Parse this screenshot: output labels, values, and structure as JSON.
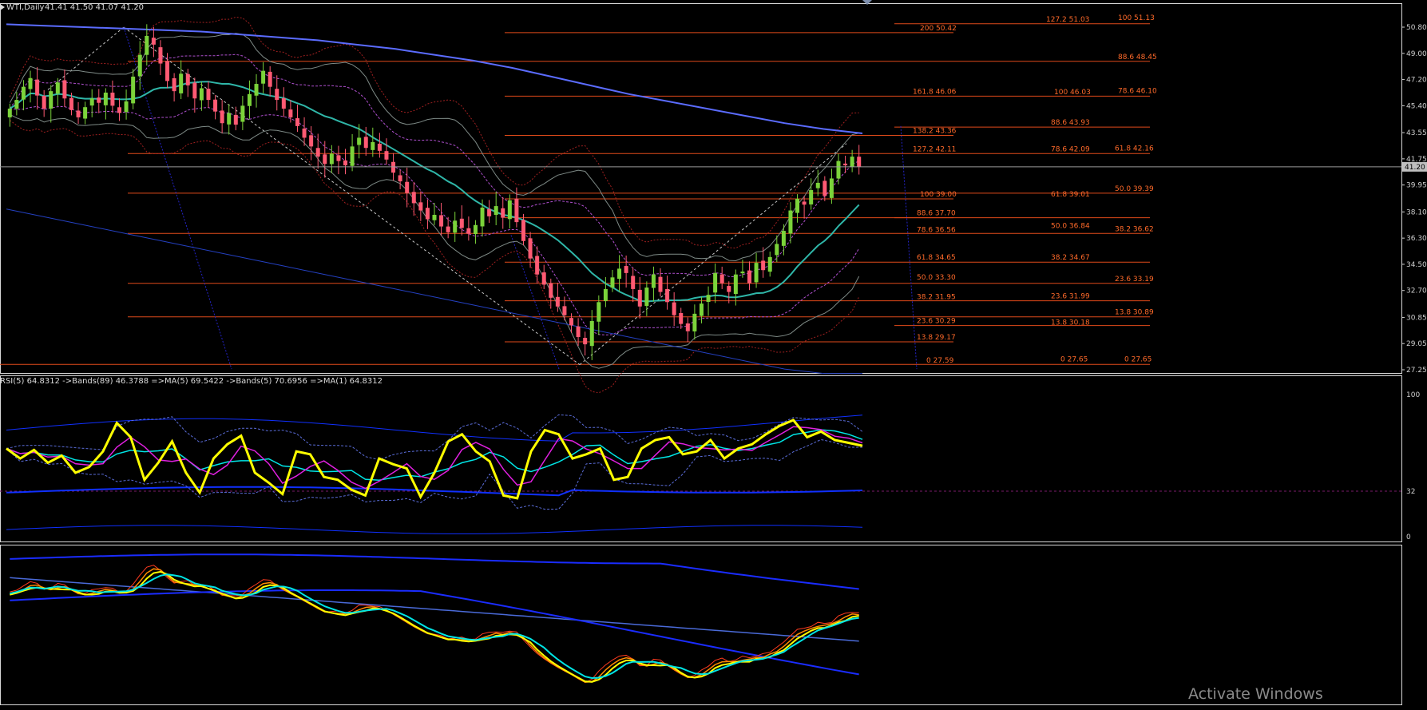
{
  "header": {
    "symbol_label": "WTI,Daily",
    "ohlc_label": "41.41 41.50 41.07 41.20"
  },
  "colors": {
    "background": "#000000",
    "bull_candle": "#7bd33a",
    "bear_candle": "#ff5a73",
    "fib_line": "#e04a1a",
    "fib_text": "#ff6a2a",
    "ma_blue": "#5b6cff",
    "ma_teal": "#2fb6a8",
    "band_gray": "#7e8a86",
    "band_purple": "#b050d0",
    "band_red": "#a02020",
    "rsi_yellow": "#ffff00",
    "rsi_cyan": "#00e5e5",
    "rsi_magenta": "#e020e0",
    "rsi_band_blue": "#1030ff",
    "axis_text": "#cfcfcf",
    "price_marker_bg": "#bfbfbf",
    "panel3_orange": "#ff8c00",
    "panel3_red": "#ff3b1f"
  },
  "price_panel": {
    "axis_labels": [
      "50.80",
      "49.00",
      "47.20",
      "45.40",
      "43.55",
      "41.75",
      "39.95",
      "38.10",
      "36.30",
      "34.50",
      "32.70",
      "30.85",
      "29.05",
      "27.25"
    ],
    "current_price": "41.20"
  },
  "fib_labels": [
    {
      "text": "127.2 51.03"
    },
    {
      "text": "100 51.13"
    },
    {
      "text": "200 50.42"
    },
    {
      "text": "88.6 48.45"
    },
    {
      "text": "161.8 46.06"
    },
    {
      "text": "100 46.03"
    },
    {
      "text": "78.6 46.10"
    },
    {
      "text": "88.6 43.93"
    },
    {
      "text": "138.2 43.36"
    },
    {
      "text": "127.2 42.11"
    },
    {
      "text": "78.6 42.09"
    },
    {
      "text": "61.8 42.16"
    },
    {
      "text": "50.0 39.39"
    },
    {
      "text": "100 39.00"
    },
    {
      "text": "61.8 39.01"
    },
    {
      "text": "88.6 37.70"
    },
    {
      "text": "78.6 36.56"
    },
    {
      "text": "50.0 36.84"
    },
    {
      "text": "38.2 36.62"
    },
    {
      "text": "61.8 34.65"
    },
    {
      "text": "38.2 34.67"
    },
    {
      "text": "50.0 33.30"
    },
    {
      "text": "23.6 33.19"
    },
    {
      "text": "38.2 31.95"
    },
    {
      "text": "23.6 31.99"
    },
    {
      "text": "13.8 30.89"
    },
    {
      "text": "23.6 30.29"
    },
    {
      "text": "13.8 30.18"
    },
    {
      "text": "13.8 29.17"
    },
    {
      "text": "0 27.59"
    },
    {
      "text": "0 27.65"
    },
    {
      "text": "0 27.65"
    }
  ],
  "rsi_panel": {
    "legend": "RSI(5) 64.8312  ->Bands(89) 46.3788  =>MA(5) 69.5422  ->Bands(5) 70.6956  =>MA(1) 64.8312",
    "axis_labels": [
      "100",
      "32",
      "0"
    ]
  },
  "watermark": "Activate Windows",
  "chart_data": {
    "type": "line",
    "title": "WTI,Daily",
    "ylim": [
      27.25,
      50.8
    ],
    "ohlc_last": {
      "open": 41.41,
      "high": 41.5,
      "low": 41.07,
      "close": 41.2
    },
    "closes": [
      45.2,
      45.8,
      46.7,
      47.3,
      46.1,
      45.2,
      46.4,
      47.0,
      45.9,
      45.1,
      44.6,
      45.3,
      45.9,
      45.6,
      46.3,
      45.4,
      44.9,
      45.7,
      47.4,
      48.9,
      50.2,
      49.6,
      48.3,
      47.1,
      46.4,
      47.6,
      46.8,
      45.9,
      46.6,
      45.8,
      45.0,
      44.2,
      44.9,
      44.1,
      45.4,
      46.2,
      46.9,
      47.8,
      46.7,
      45.8,
      45.2,
      44.6,
      44.0,
      43.2,
      42.6,
      41.9,
      41.4,
      42.1,
      41.6,
      41.3,
      42.6,
      43.2,
      42.5,
      42.9,
      42.3,
      41.7,
      40.8,
      40.2,
      39.4,
      38.7,
      38.2,
      37.6,
      37.9,
      37.1,
      36.7,
      37.5,
      37.0,
      36.6,
      37.2,
      38.4,
      37.8,
      38.5,
      37.7,
      38.9,
      37.4,
      36.1,
      34.9,
      33.8,
      33.1,
      32.2,
      31.6,
      31.0,
      30.3,
      29.5,
      29.0,
      30.6,
      31.9,
      32.8,
      33.6,
      34.2,
      33.9,
      32.8,
      31.6,
      32.9,
      33.8,
      32.6,
      31.9,
      31.0,
      30.4,
      29.9,
      31.1,
      31.8,
      32.4,
      33.9,
      33.2,
      32.6,
      33.8,
      34.0,
      33.2,
      34.6,
      34.1,
      35.0,
      35.9,
      36.8,
      38.2,
      39.0,
      38.6,
      39.6,
      40.1,
      39.2,
      40.4,
      41.6,
      41.3,
      41.9,
      41.2
    ],
    "ma_slow": [
      51.0,
      50.9,
      50.8,
      50.7,
      50.6,
      50.5,
      50.3,
      50.1,
      49.9,
      49.6,
      49.3,
      48.9,
      48.5,
      48.0,
      47.4,
      46.8,
      46.2,
      45.7,
      45.2,
      44.7,
      44.2,
      43.8,
      43.5
    ],
    "rsi5": [
      62,
      55,
      61,
      52,
      57,
      45,
      49,
      60,
      80,
      70,
      40,
      52,
      67,
      45,
      31,
      55,
      65,
      71,
      45,
      38,
      30,
      60,
      58,
      42,
      40,
      33,
      29,
      55,
      51,
      48,
      28,
      45,
      67,
      72,
      60,
      53,
      29,
      27,
      60,
      75,
      72,
      55,
      58,
      62,
      40,
      42,
      62,
      68,
      70,
      58,
      60,
      68,
      55,
      62,
      65,
      72,
      78,
      82,
      70,
      74,
      68,
      66,
      64
    ],
    "rsi_axis": [
      0,
      32,
      100
    ]
  }
}
